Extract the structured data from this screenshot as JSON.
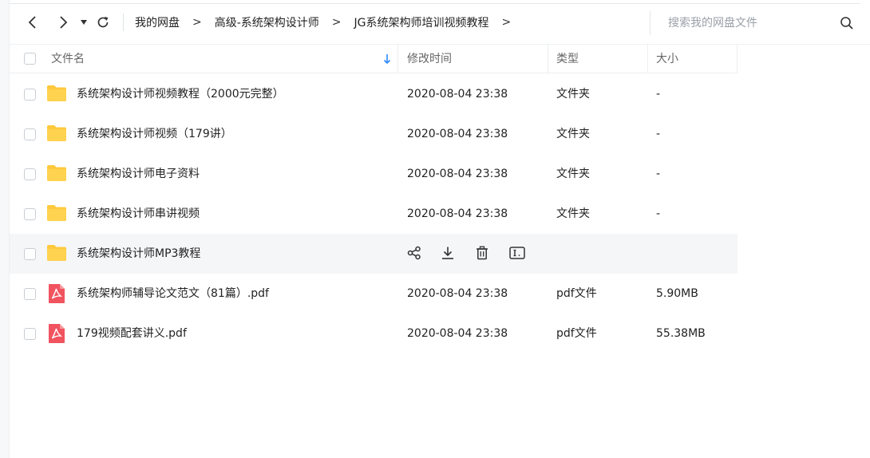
{
  "toolbar": {
    "breadcrumb": [
      "我的网盘",
      "高级-系统架构设计师",
      "JG系统架构师培训视频教程"
    ],
    "separator": ">",
    "search_placeholder": "搜索我的网盘文件"
  },
  "header": {
    "name": "文件名",
    "modified": "修改时间",
    "type": "类型",
    "size": "大小"
  },
  "files": [
    {
      "name": "系统架构设计师视频教程（2000元完整）",
      "modified": "2020-08-04 23:38",
      "type": "文件夹",
      "size": "-",
      "icon": "folder-icon"
    },
    {
      "name": "系统架构设计师视频（179讲）",
      "modified": "2020-08-04 23:38",
      "type": "文件夹",
      "size": "-",
      "icon": "folder-icon"
    },
    {
      "name": "系统架构设计师电子资料",
      "modified": "2020-08-04 23:38",
      "type": "文件夹",
      "size": "-",
      "icon": "folder-icon"
    },
    {
      "name": "系统架构设计师串讲视频",
      "modified": "2020-08-04 23:38",
      "type": "文件夹",
      "size": "-",
      "icon": "folder-icon"
    },
    {
      "name": "系统架构设计师MP3教程",
      "modified": "",
      "type": "",
      "size": "",
      "icon": "folder-icon",
      "hovered": true
    },
    {
      "name": "系统架构师辅导论文范文（81篇）.pdf",
      "modified": "2020-08-04 23:38",
      "type": "pdf文件",
      "size": "5.90MB",
      "icon": "pdf-icon"
    },
    {
      "name": "179视频配套讲义.pdf",
      "modified": "2020-08-04 23:38",
      "type": "pdf文件",
      "size": "55.38MB",
      "icon": "pdf-icon"
    }
  ],
  "row_actions": [
    "share-icon",
    "download-icon",
    "delete-icon",
    "rename-icon"
  ],
  "colors": {
    "folder": "#ffc93d",
    "pdf": "#f1535f",
    "accent": "#2f8bff",
    "hover_row": "#f5f6f8"
  }
}
